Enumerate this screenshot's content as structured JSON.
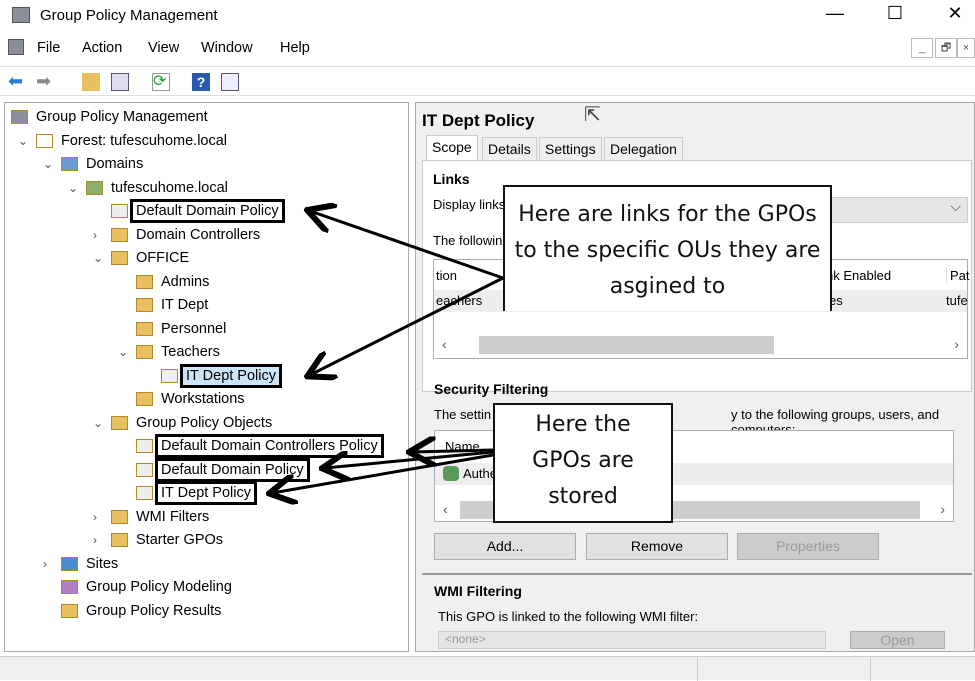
{
  "window": {
    "title": "Group Policy Management",
    "minimize": "—",
    "maximize": "☐",
    "close": "✕"
  },
  "menu": [
    "File",
    "Action",
    "View",
    "Window",
    "Help"
  ],
  "mdi": {
    "min": "_",
    "restore": "🗗",
    "close": "×"
  },
  "tree": [
    {
      "label": "Group Policy Management",
      "level": 0,
      "chev": "",
      "icon": "gpm"
    },
    {
      "label": "Forest: tufescuhome.local",
      "level": 1,
      "chev": "open",
      "icon": "forest"
    },
    {
      "label": "Domains",
      "level": 2,
      "chev": "open",
      "icon": "domains"
    },
    {
      "label": "tufescuhome.local",
      "level": 3,
      "chev": "open",
      "icon": "domain"
    },
    {
      "label": "Default Domain Policy",
      "level": 4,
      "chev": "",
      "icon": "gpo-link",
      "boxed": true
    },
    {
      "label": "Domain Controllers",
      "level": 4,
      "chev": "closed",
      "icon": "ou"
    },
    {
      "label": "OFFICE",
      "level": 4,
      "chev": "open",
      "icon": "ou"
    },
    {
      "label": "Admins",
      "level": 5,
      "chev": "",
      "icon": "ou"
    },
    {
      "label": "IT Dept",
      "level": 5,
      "chev": "",
      "icon": "ou"
    },
    {
      "label": "Personnel",
      "level": 5,
      "chev": "",
      "icon": "ou"
    },
    {
      "label": "Teachers",
      "level": 5,
      "chev": "open",
      "icon": "ou"
    },
    {
      "label": "IT Dept Policy",
      "level": 6,
      "chev": "",
      "icon": "gpo-link",
      "boxed": true,
      "selected": true
    },
    {
      "label": "Workstations",
      "level": 5,
      "chev": "",
      "icon": "ou"
    },
    {
      "label": "Group Policy Objects",
      "level": 4,
      "chev": "open",
      "icon": "ou"
    },
    {
      "label": "Default Domain Controllers Policy",
      "level": 5,
      "chev": "",
      "icon": "gpo",
      "boxed": true
    },
    {
      "label": "Default Domain Policy",
      "level": 5,
      "chev": "",
      "icon": "gpo",
      "boxed": true
    },
    {
      "label": "IT Dept Policy",
      "level": 5,
      "chev": "",
      "icon": "gpo",
      "boxed": true
    },
    {
      "label": "WMI Filters",
      "level": 4,
      "chev": "closed",
      "icon": "ou"
    },
    {
      "label": "Starter GPOs",
      "level": 4,
      "chev": "closed",
      "icon": "ou"
    },
    {
      "label": "Sites",
      "level": 2,
      "chev": "closed",
      "icon": "sites"
    },
    {
      "label": "Group Policy Modeling",
      "level": 2,
      "chev": "",
      "icon": "modeling"
    },
    {
      "label": "Group Policy Results",
      "level": 2,
      "chev": "",
      "icon": "results"
    }
  ],
  "detail": {
    "title": "IT Dept Policy",
    "tabs": [
      "Scope",
      "Details",
      "Settings",
      "Delegation"
    ],
    "links": {
      "heading": "Links",
      "display_label": "Display links",
      "following": "The followin",
      "columns": [
        "tion",
        "nk Enabled",
        "Pat"
      ],
      "row": [
        "eachers",
        "es",
        "tufe"
      ]
    },
    "security": {
      "heading": "Security Filtering",
      "desc_start": "The settin",
      "desc_end": "y to the following groups, users, and computers:",
      "column": "Name",
      "row": "Authe",
      "buttons": [
        "Add...",
        "Remove",
        "Properties"
      ]
    },
    "wmi": {
      "heading": "WMI Filtering",
      "desc": "This GPO is linked to the following WMI filter:",
      "value": "<none>",
      "open": "Open"
    }
  },
  "annotations": {
    "links": "Here are links for the GPOs to the specific OUs they are asgined to",
    "stored": "Here the GPOs are stored"
  }
}
